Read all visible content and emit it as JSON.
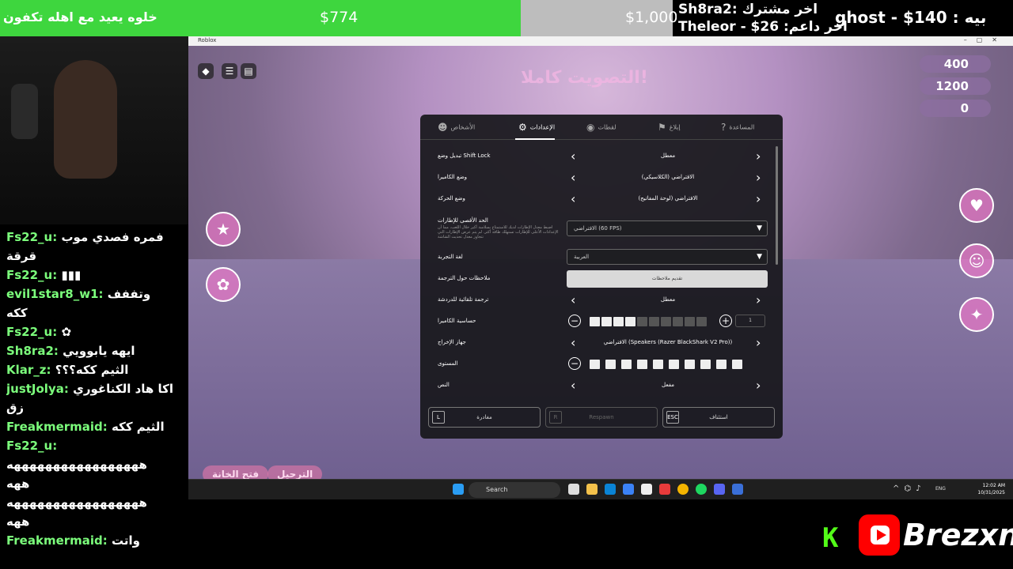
{
  "goal": {
    "text": "خلوه يعيد مع اهله تكفون",
    "current": "$774",
    "target": "$1,000",
    "progress": 0.774,
    "fill_color": "#3ed63e"
  },
  "alerts": {
    "subscriber": "Sh8ra2: اخر مشترك",
    "donor": "Theleor - $26 :اخر داعم",
    "top": "ghost - $140 : بيه"
  },
  "chat": [
    {
      "user": "Fs22_u:",
      "text": "فمره فصدي موب"
    },
    {
      "user": "",
      "text": "قرقة"
    },
    {
      "user": "Fs22_u:",
      "text": "▮▮▮"
    },
    {
      "user": "evil1star8_w1:",
      "text": "وتففف"
    },
    {
      "user": "",
      "text": "ككه"
    },
    {
      "user": "Fs22_u:",
      "text": "✿"
    },
    {
      "user": "Sh8ra2:",
      "text": "ايهه يابوويي"
    },
    {
      "user": "Klar_z:",
      "text": "الثيم ككه؟؟؟"
    },
    {
      "user": "justJolya:",
      "text": "اكا هاد الكناغوري"
    },
    {
      "user": "",
      "text": "زق"
    },
    {
      "user": "Freakmermaid:",
      "text": "الثيم ككه"
    },
    {
      "user": "Fs22_u:",
      "text": ""
    },
    {
      "user": "",
      "text": "هههههههههههههههههه"
    },
    {
      "user": "",
      "text": "ههه"
    },
    {
      "user": "",
      "text": "هههههههههههههههههه"
    },
    {
      "user": "",
      "text": "ههه"
    },
    {
      "user": "Freakmermaid:",
      "text": "واتت"
    }
  ],
  "window": {
    "title": "Roblox"
  },
  "game": {
    "title": "التصويت كاملا!",
    "stats": [
      "400",
      "1200",
      "0"
    ],
    "bottom_buttons": [
      "فتح الخانة",
      "الترحيل"
    ]
  },
  "settings": {
    "tabs": [
      {
        "icon": "people-icon",
        "label": "الأشخاص"
      },
      {
        "icon": "gear-icon",
        "label": "الإعدادات",
        "active": true
      },
      {
        "icon": "camera-icon",
        "label": "لقطات"
      },
      {
        "icon": "flag-icon",
        "label": "إبلاغ"
      },
      {
        "icon": "help-icon",
        "label": "المساعدة"
      }
    ],
    "rows": {
      "shift_lock": {
        "label": "تبديل وضع Shift Lock",
        "value": "معطل"
      },
      "camera_mode": {
        "label": "وضع الكاميرا",
        "value": "الافتراضي (الكلاسيكي)"
      },
      "movement_mode": {
        "label": "وضع الحركة",
        "value": "الافتراضي (لوحة المفاتيح)"
      },
      "max_fps": {
        "label": "الحد الأقصى للإطارات",
        "desc": "اضبط معدل الإطارات لديك للاستمتاع بسلاسة أكبر خلال اللعب، مما أن الإعدادات الأعلى للإطارات تستهلك طاقة أكثر. لم يتم عرض الإطارات التي تتجاوز معدل تحديث الشاشة",
        "value": "الافتراضي (60 FPS)"
      },
      "language": {
        "label": "لغة التجربة",
        "value": "العربية"
      },
      "translation_feedback": {
        "label": "ملاحظات حول الترجمة",
        "value": "تقديم ملاحظات"
      },
      "auto_translate": {
        "label": "ترجمة تلقائية للدردشة",
        "value": "معطل"
      },
      "camera_sensitivity": {
        "label": "حساسية الكاميرا",
        "value": "1",
        "level": 0.4
      },
      "output_device": {
        "label": "جهاز الإخراج",
        "value": "الافتراضي (Speakers (Razer BlackShark V2 Pro))"
      },
      "volume": {
        "label": "المستوى",
        "level": 1.0
      },
      "fullscreen": {
        "label": "النص",
        "value": "مفعل"
      }
    },
    "footer": [
      {
        "key": "L",
        "label": "مغادرة",
        "disabled": false
      },
      {
        "key": "R",
        "label": "Respawn",
        "disabled": true
      },
      {
        "key": "ESC",
        "label": "استئناف",
        "disabled": false
      }
    ]
  },
  "taskbar": {
    "search": "Search",
    "lang": "ENG",
    "time": "12:02 AM",
    "date": "10/31/2025"
  },
  "brand": {
    "kick": "K",
    "name": "Brezxn"
  }
}
